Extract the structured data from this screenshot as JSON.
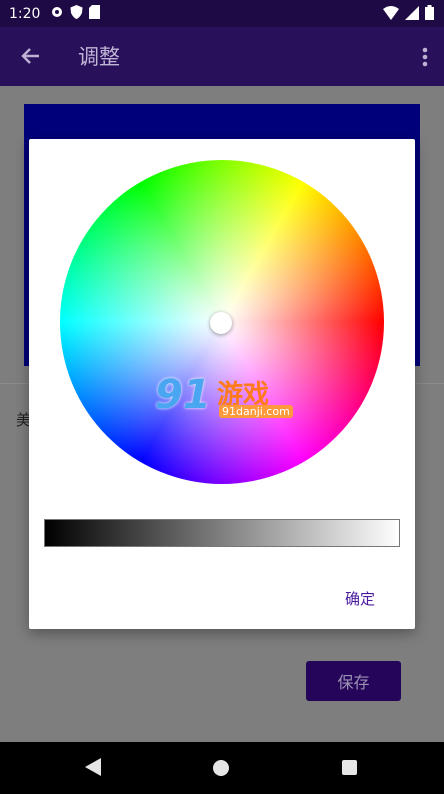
{
  "status_bar": {
    "time": "1:20"
  },
  "app_bar": {
    "title": "调整"
  },
  "content": {
    "left_label": "美",
    "save_label": "保存",
    "preview_color": "#00007a"
  },
  "dialog": {
    "confirm_label": "确定"
  },
  "watermark": {
    "number": "91",
    "text": "游戏",
    "url": "91danji.com"
  },
  "icons": [
    "gear-icon",
    "shield-icon",
    "sd-card-icon",
    "wifi-icon",
    "signal-icon",
    "battery-icon",
    "back-arrow-icon",
    "more-vert-icon",
    "nav-back-icon",
    "nav-home-icon",
    "nav-recent-icon"
  ]
}
